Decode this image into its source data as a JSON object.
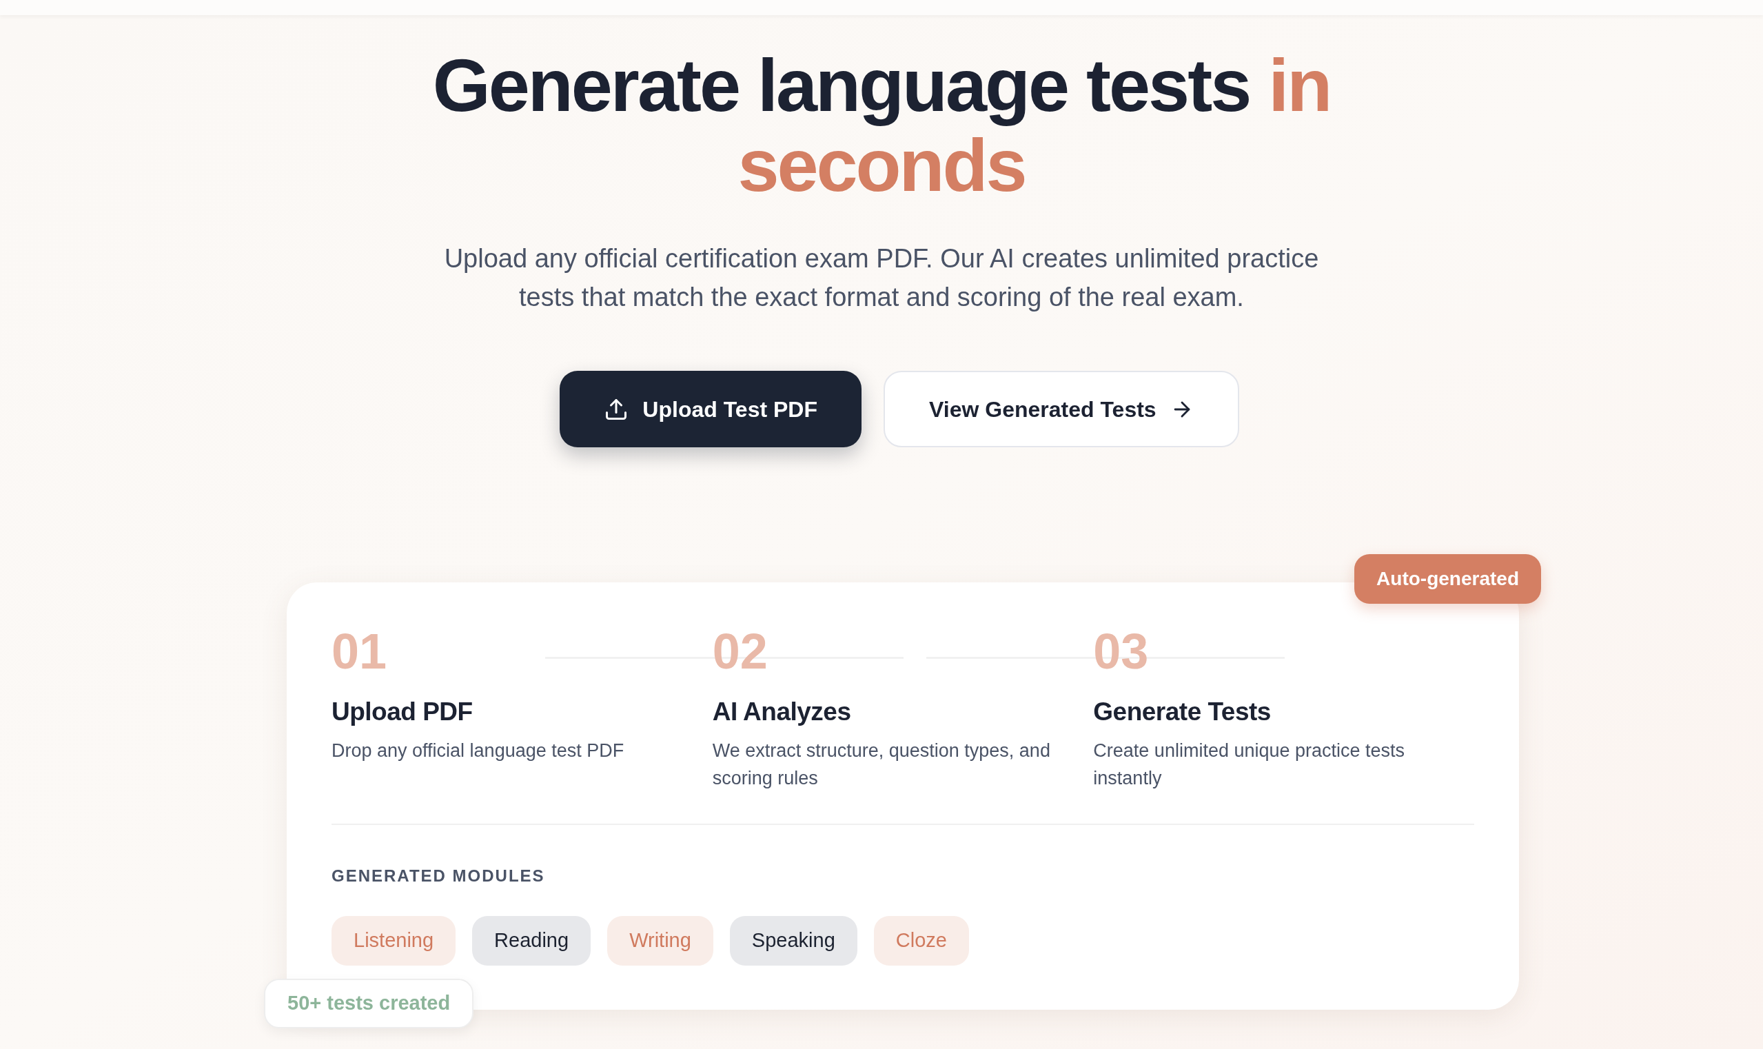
{
  "hero": {
    "title": "Generate language tests",
    "title_highlight": "in seconds",
    "subtitle": "Upload any official certification exam PDF. Our AI creates unlimited practice tests that match the exact format and scoring of the real exam.",
    "buttons": [
      {
        "kind": "primary",
        "label": "Upload Test PDF"
      },
      {
        "kind": "secondary",
        "label": "View Generated Tests"
      }
    ]
  },
  "card": {
    "badge": "Auto-generated",
    "steps": [
      {
        "number": "01",
        "title": "Upload PDF",
        "description": "Drop any official language test PDF"
      },
      {
        "number": "02",
        "title": "AI Analyzes",
        "description": "We extract structure, question types, and scoring rules"
      },
      {
        "number": "03",
        "title": "Generate Tests",
        "description": "Create unlimited unique practice tests instantly"
      }
    ],
    "modules_label": "GENERATED MODULES",
    "modules": [
      {
        "label": "Listening",
        "kind": "accent"
      },
      {
        "label": "Reading",
        "kind": "neutral"
      },
      {
        "label": "Writing",
        "kind": "accent"
      },
      {
        "label": "Speaking",
        "kind": "neutral"
      },
      {
        "label": "Cloze",
        "kind": "accent"
      }
    ],
    "stat": "50+ tests created"
  }
}
